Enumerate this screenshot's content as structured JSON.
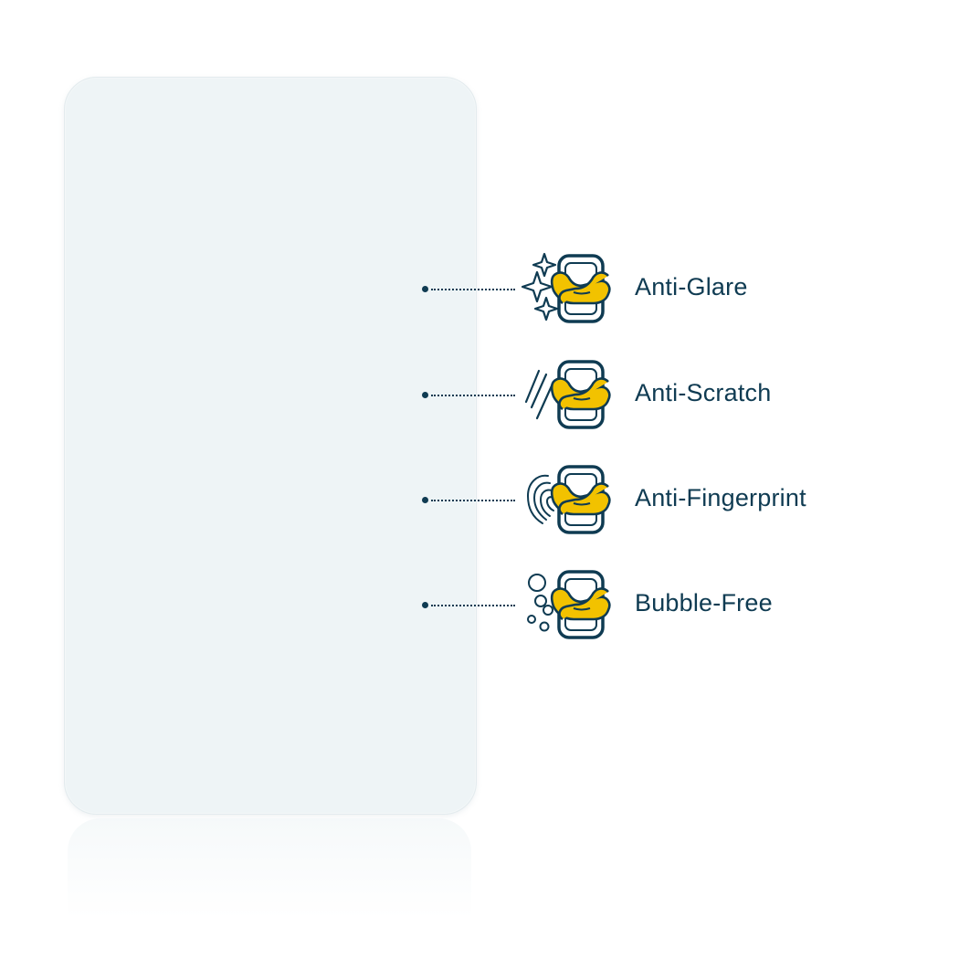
{
  "product": {
    "film": "screen-protector-film"
  },
  "colors": {
    "accent": "#f2c200",
    "outline": "#0f3b52",
    "film": "#eef4f6"
  },
  "features": [
    {
      "label": "Anti-Glare",
      "icon": "sparkle-icon"
    },
    {
      "label": "Anti-Scratch",
      "icon": "scratch-lines-icon"
    },
    {
      "label": "Anti-Fingerprint",
      "icon": "fingerprint-icon"
    },
    {
      "label": "Bubble-Free",
      "icon": "bubbles-icon"
    }
  ]
}
